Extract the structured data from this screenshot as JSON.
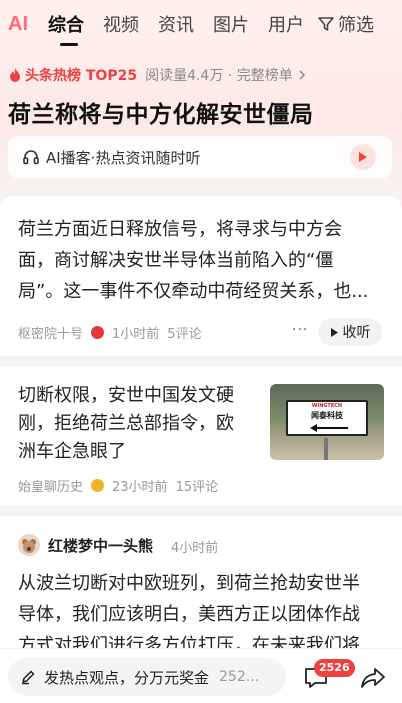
{
  "tabs": {
    "ai_label": "AI",
    "items": [
      "综合",
      "视频",
      "资讯",
      "图片",
      "用户"
    ],
    "filter_label": "筛选"
  },
  "hot": {
    "label": "头条热榜 TOP25",
    "meta": "阅读量4.4万 · 完整榜单"
  },
  "headline": "荷兰称将与中方化解安世僵局",
  "ai_bar": {
    "text": "AI播客·热点资讯随时听"
  },
  "article1": {
    "lines": [
      "荷兰方面近日释放信号，将寻求与中方会",
      "面，商讨解决安世半导体当前陷入的“僵",
      "局”。这一事件不仅牵动中荷经贸关系，也..."
    ],
    "source": "枢密院十号",
    "time": "1小时前",
    "comments": "5评论",
    "more": "···",
    "listen": "收听"
  },
  "article2": {
    "lines": [
      "切断权限，安世中国发文硬",
      "刚，拒绝荷兰总部指令，欧",
      "洲车企急眼了"
    ],
    "source": "始皇聊历史",
    "time": "23小时前",
    "comments": "15评论",
    "thumb_brand": "WINGTECH",
    "thumb_name": "闻泰科技"
  },
  "post3": {
    "author": "红楼梦中一头熊",
    "time": "4小时前",
    "lines": [
      "从波兰切断对中欧班列，到荷兰抢劫安世半",
      "导体，我们应该明白，美西方正以团体作战",
      "方式对我们进行多方位打压，在未来我们将"
    ]
  },
  "bottom": {
    "compose": "发热点观点，分万元奖金",
    "compose_count": "252...",
    "comment_count": "2526"
  },
  "colors": {
    "accent": "#f04142",
    "ai_pink": "#ff6b7a"
  }
}
